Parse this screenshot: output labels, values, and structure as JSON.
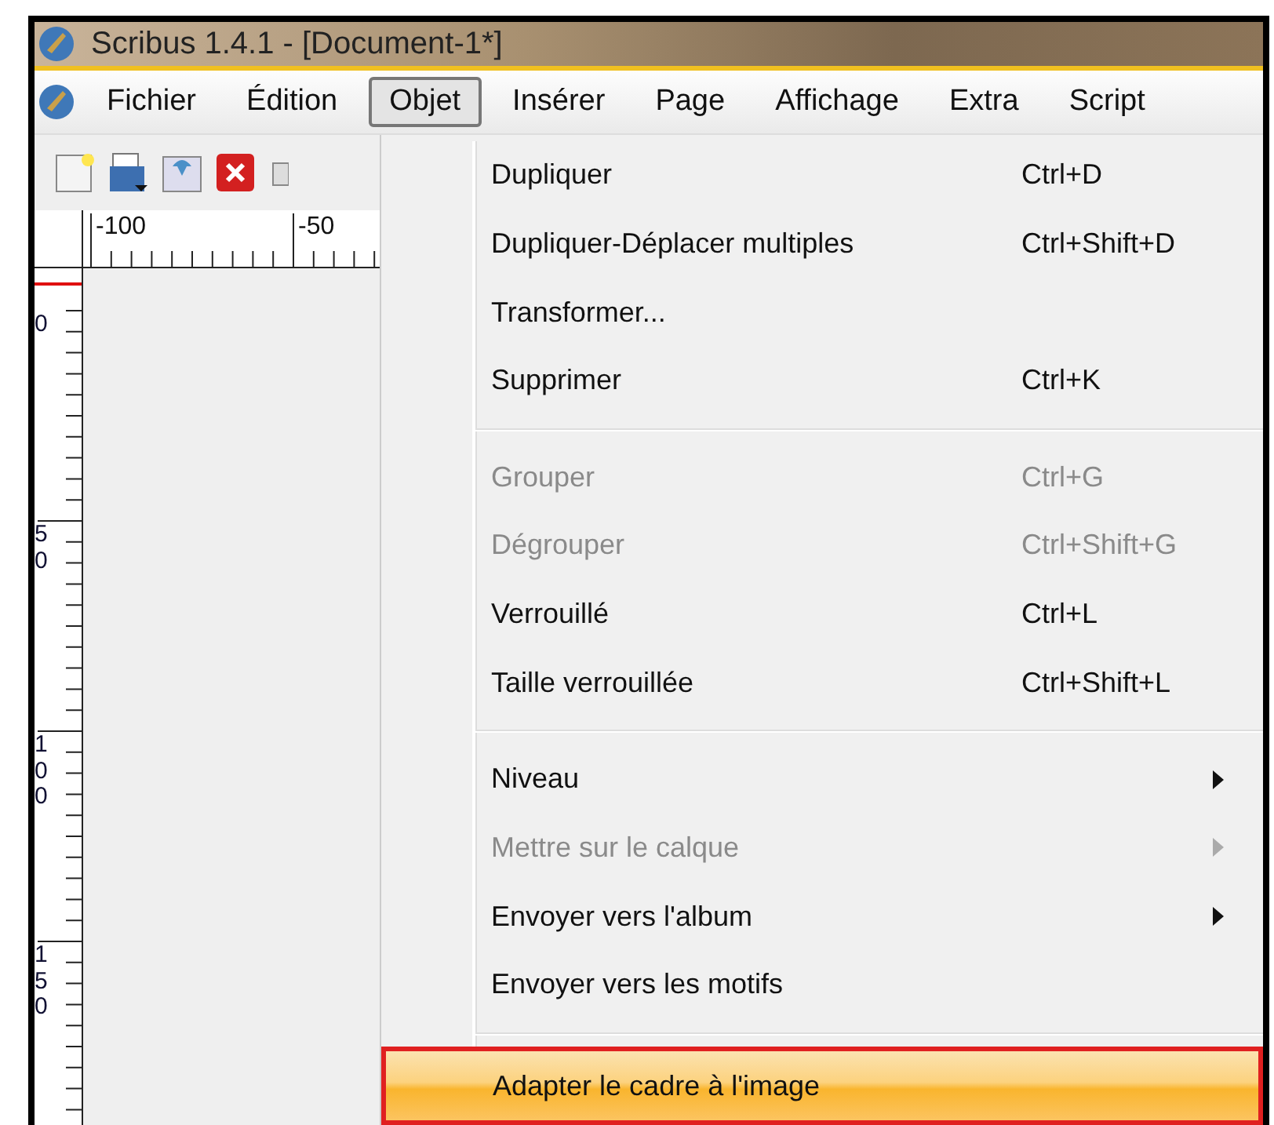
{
  "window": {
    "title": "Scribus 1.4.1 - [Document-1*]"
  },
  "menubar": [
    {
      "label": "Fichier",
      "selected": false
    },
    {
      "label": "Édition",
      "selected": false
    },
    {
      "label": "Objet",
      "selected": true
    },
    {
      "label": "Insérer",
      "selected": false
    },
    {
      "label": "Page",
      "selected": false
    },
    {
      "label": "Affichage",
      "selected": false
    },
    {
      "label": "Extra",
      "selected": false
    },
    {
      "label": "Script",
      "selected": false
    }
  ],
  "rulers": {
    "top_labels": [
      "-100",
      "-50"
    ],
    "left_labels": [
      "0",
      "50",
      "100",
      "150"
    ]
  },
  "menu": {
    "items": [
      {
        "kind": "item",
        "label": "Dupliquer",
        "shortcut": "Ctrl+D",
        "disabled": false,
        "submenu": false,
        "selected": false
      },
      {
        "kind": "item",
        "label": "Dupliquer-Déplacer multiples",
        "shortcut": "Ctrl+Shift+D",
        "disabled": false,
        "submenu": false,
        "selected": false
      },
      {
        "kind": "item",
        "label": "Transformer...",
        "disabled": false,
        "submenu": false,
        "selected": false
      },
      {
        "kind": "item",
        "label": "Supprimer",
        "shortcut": "Ctrl+K",
        "disabled": false,
        "submenu": false,
        "selected": false
      },
      {
        "kind": "separator"
      },
      {
        "kind": "item",
        "label": "Grouper",
        "shortcut": "Ctrl+G",
        "disabled": true,
        "submenu": false,
        "selected": false
      },
      {
        "kind": "item",
        "label": "Dégrouper",
        "shortcut": "Ctrl+Shift+G",
        "disabled": true,
        "submenu": false,
        "selected": false
      },
      {
        "kind": "item",
        "label": "Verrouillé",
        "shortcut": "Ctrl+L",
        "disabled": false,
        "submenu": false,
        "selected": false
      },
      {
        "kind": "item",
        "label": "Taille verrouillée",
        "shortcut": "Ctrl+Shift+L",
        "disabled": false,
        "submenu": false,
        "selected": false
      },
      {
        "kind": "separator"
      },
      {
        "kind": "item",
        "label": "Niveau",
        "disabled": false,
        "submenu": true,
        "selected": false
      },
      {
        "kind": "item",
        "label": "Mettre sur le calque",
        "disabled": true,
        "submenu": true,
        "selected": false
      },
      {
        "kind": "item",
        "label": "Envoyer vers l'album",
        "disabled": false,
        "submenu": true,
        "selected": false
      },
      {
        "kind": "item",
        "label": "Envoyer vers les motifs",
        "disabled": false,
        "submenu": false,
        "selected": false
      },
      {
        "kind": "separator"
      },
      {
        "kind": "item",
        "label": "Adapter le cadre à l'image",
        "disabled": false,
        "submenu": false,
        "selected": true
      }
    ]
  }
}
